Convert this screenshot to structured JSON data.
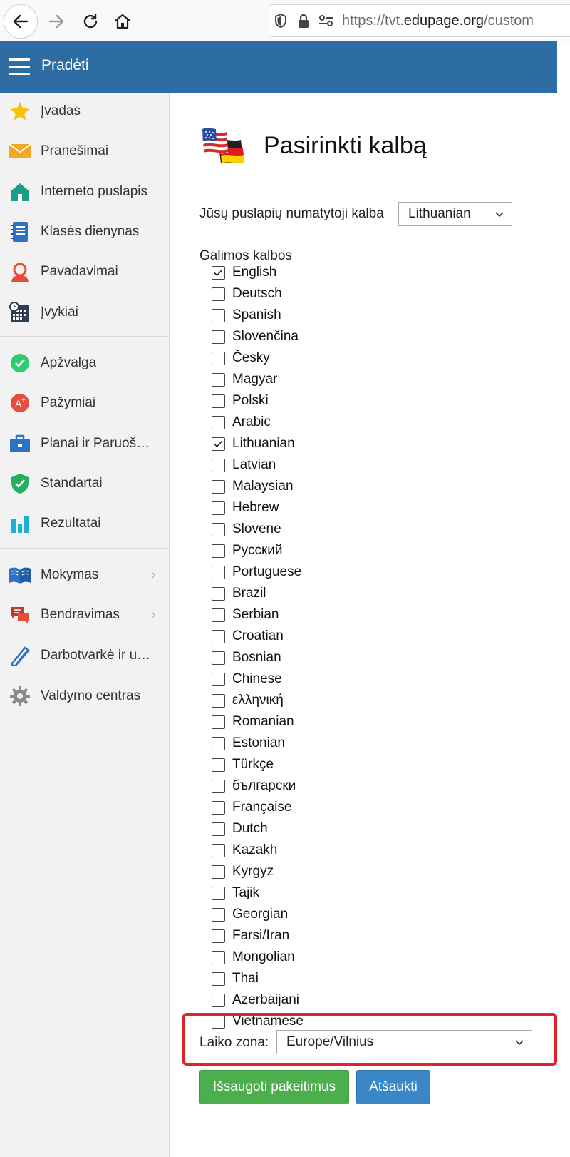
{
  "browser": {
    "url_scheme": "https://tvt.",
    "url_domain": "edupage.org",
    "url_path": "/custom"
  },
  "header": {
    "title": "Pradėti"
  },
  "sidebar": {
    "items": [
      {
        "label": "Įvadas",
        "icon": "star-icon"
      },
      {
        "label": "Pranešimai",
        "icon": "envelope-icon"
      },
      {
        "label": "Interneto puslapis",
        "icon": "house-icon"
      },
      {
        "label": "Klasės dienynas",
        "icon": "notebook-icon"
      },
      {
        "label": "Pavadavimai",
        "icon": "person-icon"
      },
      {
        "label": "Įvykiai",
        "icon": "calendar-icon"
      },
      {
        "label": "Apžvalga",
        "icon": "check-badge-icon"
      },
      {
        "label": "Pažymiai",
        "icon": "grade-icon"
      },
      {
        "label": "Planai ir Paruošimai",
        "icon": "briefcase-icon"
      },
      {
        "label": "Standartai",
        "icon": "shield-check-icon"
      },
      {
        "label": "Rezultatai",
        "icon": "bar-chart-icon"
      },
      {
        "label": "Mokymas",
        "icon": "book-icon"
      },
      {
        "label": "Bendravimas",
        "icon": "chat-icon"
      },
      {
        "label": "Darbotvarkė ir užduotys",
        "icon": "pen-icon"
      },
      {
        "label": "Valdymo centras",
        "icon": "gear-icon"
      }
    ]
  },
  "main": {
    "title": "Pasirinkti kalbą",
    "default_language_label": "Jūsų puslapių numatytoji kalba",
    "default_language_value": "Lithuanian",
    "available_languages_label": "Galimos kalbos",
    "languages": [
      {
        "name": "English",
        "checked": true
      },
      {
        "name": "Deutsch",
        "checked": false
      },
      {
        "name": "Spanish",
        "checked": false
      },
      {
        "name": "Slovenčina",
        "checked": false
      },
      {
        "name": "Česky",
        "checked": false
      },
      {
        "name": "Magyar",
        "checked": false
      },
      {
        "name": "Polski",
        "checked": false
      },
      {
        "name": "Arabic",
        "checked": false
      },
      {
        "name": "Lithuanian",
        "checked": true
      },
      {
        "name": "Latvian",
        "checked": false
      },
      {
        "name": "Malaysian",
        "checked": false
      },
      {
        "name": "Hebrew",
        "checked": false
      },
      {
        "name": "Slovene",
        "checked": false
      },
      {
        "name": "Русский",
        "checked": false
      },
      {
        "name": "Portuguese",
        "checked": false
      },
      {
        "name": "Brazil",
        "checked": false
      },
      {
        "name": "Serbian",
        "checked": false
      },
      {
        "name": "Croatian",
        "checked": false
      },
      {
        "name": "Bosnian",
        "checked": false
      },
      {
        "name": "Chinese",
        "checked": false
      },
      {
        "name": "ελληνική",
        "checked": false
      },
      {
        "name": "Romanian",
        "checked": false
      },
      {
        "name": "Estonian",
        "checked": false
      },
      {
        "name": "Türkçe",
        "checked": false
      },
      {
        "name": "български",
        "checked": false
      },
      {
        "name": "Française",
        "checked": false
      },
      {
        "name": "Dutch",
        "checked": false
      },
      {
        "name": "Kazakh",
        "checked": false
      },
      {
        "name": "Kyrgyz",
        "checked": false
      },
      {
        "name": "Tajik",
        "checked": false
      },
      {
        "name": "Georgian",
        "checked": false
      },
      {
        "name": "Farsi/Iran",
        "checked": false
      },
      {
        "name": "Mongolian",
        "checked": false
      },
      {
        "name": "Thai",
        "checked": false
      },
      {
        "name": "Azerbaijani",
        "checked": false
      },
      {
        "name": "Vietnamese",
        "checked": false
      }
    ],
    "timezone_label": "Laiko zona:",
    "timezone_value": "Europe/Vilnius",
    "save_label": "Išsaugoti pakeitimus",
    "cancel_label": "Atšaukti"
  },
  "colors": {
    "header_bg": "#2e6da4",
    "save_button": "#4cae4c",
    "cancel_button": "#3a87c8",
    "highlight": "#e0222a"
  }
}
